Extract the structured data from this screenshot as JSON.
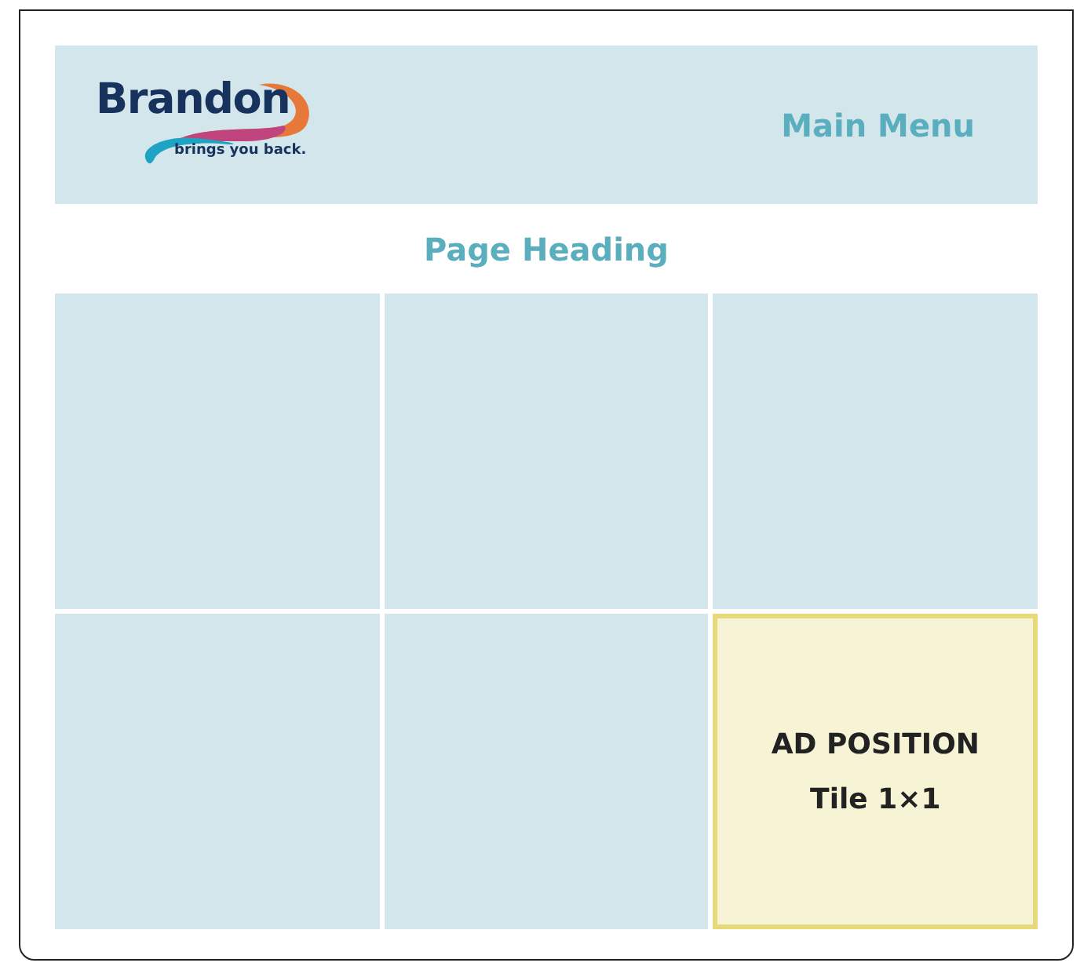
{
  "header": {
    "logo": {
      "name": "Brandon",
      "tagline": "brings you back."
    },
    "menu_link": "Main Menu"
  },
  "page_heading": "Page Heading",
  "tiles": [
    {
      "kind": "blank"
    },
    {
      "kind": "blank"
    },
    {
      "kind": "blank"
    },
    {
      "kind": "blank"
    },
    {
      "kind": "blank"
    },
    {
      "kind": "ad",
      "title": "AD POSITION",
      "subtitle": "Tile 1×1"
    }
  ]
}
